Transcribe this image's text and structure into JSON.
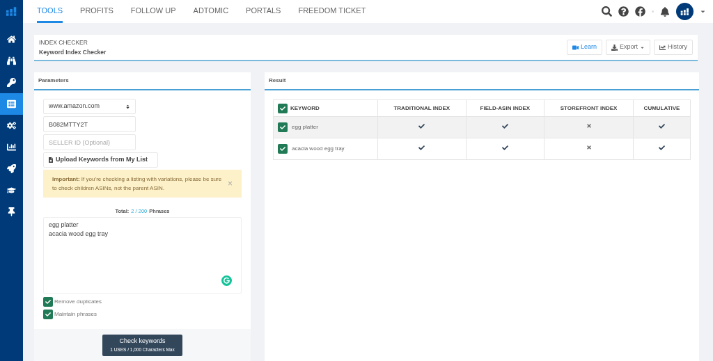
{
  "sidebar": {
    "items": [
      {
        "kind": "home",
        "selected": false
      },
      {
        "kind": "binoculars",
        "selected": false
      },
      {
        "kind": "keys",
        "selected": false
      },
      {
        "kind": "list",
        "selected": true
      },
      {
        "kind": "gears",
        "selected": false
      },
      {
        "kind": "chart",
        "selected": false
      },
      {
        "kind": "rocket",
        "selected": false
      },
      {
        "kind": "cap",
        "selected": false
      },
      {
        "kind": "pin",
        "selected": false
      }
    ]
  },
  "nav": {
    "tabs": [
      {
        "label": "TOOLS",
        "selected": true
      },
      {
        "label": "PROFITS",
        "selected": false
      },
      {
        "label": "FOLLOW UP",
        "selected": false
      },
      {
        "label": "ADTOMIC",
        "selected": false
      },
      {
        "label": "PORTALS",
        "selected": false
      },
      {
        "label": "FREEDOM TICKET",
        "selected": false
      }
    ]
  },
  "header": {
    "title": "INDEX CHECKER",
    "subtitle": "Keyword Index Checker",
    "buttons": [
      {
        "kind": "learn",
        "label": "Learn"
      },
      {
        "kind": "export",
        "label": "Export"
      },
      {
        "kind": "history",
        "label": "History"
      }
    ]
  },
  "parameters": {
    "title": "Parameters",
    "marketplace": "www.amazon.com",
    "asin": "B082MTTY2T",
    "seller_placeholder": "SELLER ID (Optional)",
    "upload_button": "Upload Keywords from My List",
    "notice": {
      "text": "**Important:** If you’re checking a listing with variations, please be sure to check children ASINs, not the parent ASIN.",
      "close": "×"
    },
    "total_label": "Total:",
    "total_count": "2 / 200",
    "total_unit": "Phrases",
    "keywords": "egg platter\nacacia wood egg tray",
    "options": [
      {
        "label": "Remove duplicates",
        "checked": true
      },
      {
        "label": "Maintain phrases",
        "checked": true
      }
    ],
    "submit": {
      "label": "Check keywords",
      "note": "1 USES / 1,000 Characters Max"
    }
  },
  "result": {
    "title": "Result",
    "table": {
      "all_checked": true,
      "columns": [
        "KEYWORD",
        "TRADITIONAL INDEX",
        "FIELD-ASIN INDEX",
        "STOREFRONT INDEX",
        "CUMULATIVE"
      ],
      "rows": [
        {
          "keyword": "egg platter",
          "checked": true,
          "selected": true,
          "indexed": [
            true,
            true,
            false,
            true
          ]
        },
        {
          "keyword": "acacia wood egg tray",
          "checked": true,
          "selected": false,
          "indexed": [
            true,
            true,
            false,
            true
          ]
        }
      ]
    }
  }
}
